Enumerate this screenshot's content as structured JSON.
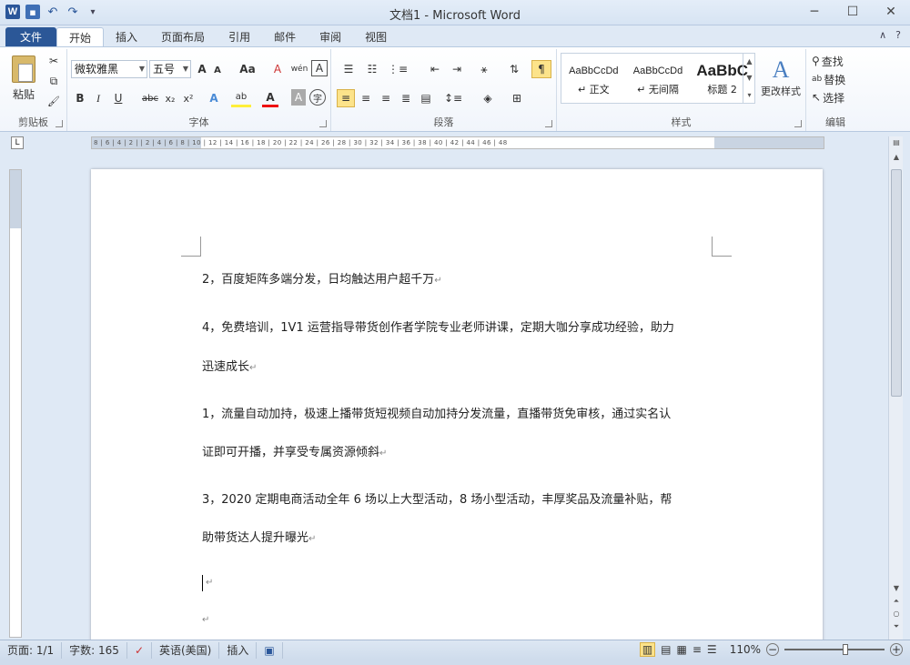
{
  "window": {
    "title": "文档1 - Microsoft Word",
    "minimize": "─",
    "maximize": "☐",
    "close": "✕"
  },
  "qat": {
    "word_icon": "W",
    "save_icon": "save-icon",
    "undo": "↶",
    "redo": "↷",
    "customize": "▾"
  },
  "tabs": [
    "文件",
    "开始",
    "插入",
    "页面布局",
    "引用",
    "邮件",
    "审阅",
    "视图"
  ],
  "tab_right": {
    "collapse": "∧",
    "help": "?"
  },
  "ribbon": {
    "clipboard": {
      "label": "剪贴板",
      "paste": "粘贴",
      "cut": "✂",
      "copy": "⧉",
      "format_painter": "🖌"
    },
    "font": {
      "label": "字体",
      "font_name": "微软雅黑",
      "font_size": "五号",
      "grow": "A",
      "shrink": "A",
      "change_case": "Aa",
      "clear": "A",
      "phonetic": "wén",
      "border": "A",
      "bold": "B",
      "italic": "I",
      "underline": "U",
      "strike": "abc",
      "subscript": "x₂",
      "superscript": "x²",
      "effects": "A",
      "highlight": "ab",
      "font_color": "A",
      "shading": "A",
      "enclose": "字"
    },
    "paragraph": {
      "label": "段落"
    },
    "styles": {
      "label": "样式",
      "items": [
        {
          "preview": "AaBbCcDd",
          "name": "↵ 正文"
        },
        {
          "preview": "AaBbCcDd",
          "name": "↵ 无间隔"
        },
        {
          "preview": "AaBbC",
          "name": "标题 2"
        }
      ],
      "change": "更改样式"
    },
    "editing": {
      "label": "编辑",
      "find": "查找",
      "replace": "替换",
      "select": "选择"
    }
  },
  "ruler_marks": "8 | 6 | 4 | 2 | | 2 | 4 | 6 | 8 | 10 | 12 | 14 | 16 | 18 | 20 | 22 | 24 | 26 | 28 | 30 | 32 | 34 | 36 | 38 | 40 | 42 | 44 | 46 | 48",
  "document": {
    "paragraphs": [
      "2，百度矩阵多端分发，日均触达用户超千万",
      "4，免费培训，1V1 运营指导带货创作者学院专业老师讲课，定期大咖分享成功经验，助力",
      "迅速成长",
      "1，流量自动加持，极速上播带货短视频自动加持分发流量，直播带货免审核，通过实名认",
      "证即可开播，并享受专属资源倾斜",
      "3，2020 定期电商活动全年 6 场以上大型活动，8 场小型活动，丰厚奖品及流量补贴，帮",
      "助带货达人提升曝光"
    ],
    "para_mark": "↵"
  },
  "statusbar": {
    "page": "页面: 1/1",
    "words": "字数: 165",
    "language": "英语(美国)",
    "mode": "插入",
    "zoom": "110%",
    "zoom_minus": "−",
    "zoom_plus": "+"
  }
}
